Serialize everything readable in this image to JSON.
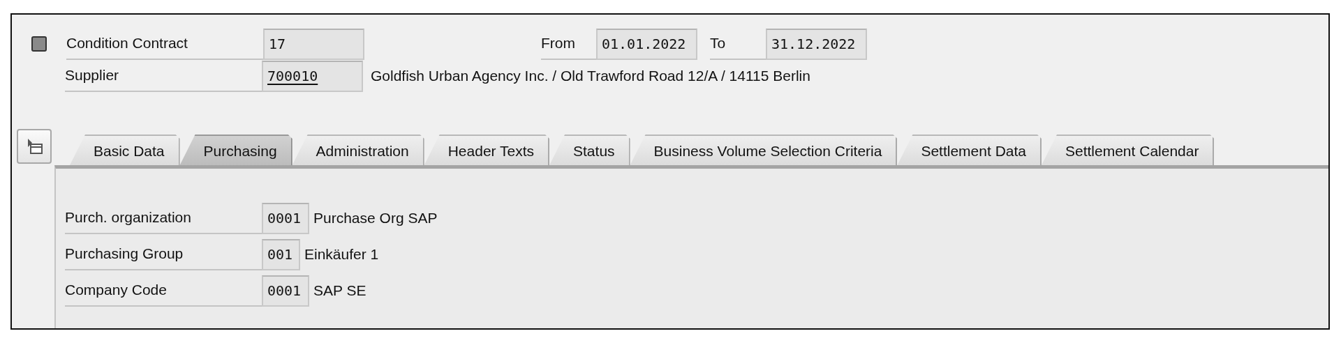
{
  "header": {
    "contract": {
      "label": "Condition Contract",
      "value": "17"
    },
    "from": {
      "label": "From",
      "value": "01.01.2022"
    },
    "to": {
      "label": "To",
      "value": "31.12.2022"
    },
    "supplier": {
      "label": "Supplier",
      "value": "700010",
      "underlined": true,
      "description": "Goldfish Urban Agency Inc. / Old Trawford Road 12/A / 14115 Berlin"
    }
  },
  "tabs": [
    {
      "label": "Basic Data",
      "selected": false
    },
    {
      "label": "Purchasing",
      "selected": true
    },
    {
      "label": "Administration",
      "selected": false
    },
    {
      "label": "Header Texts",
      "selected": false
    },
    {
      "label": "Status",
      "selected": false
    },
    {
      "label": "Business Volume Selection Criteria",
      "selected": false
    },
    {
      "label": "Settlement Data",
      "selected": false
    },
    {
      "label": "Settlement Calendar",
      "selected": false
    }
  ],
  "panel": {
    "fields": [
      {
        "label": "Purch. organization",
        "value": "0001",
        "description": "Purchase Org SAP"
      },
      {
        "label": "Purchasing Group",
        "value": "001",
        "description": "Einkäufer 1"
      },
      {
        "label": "Company Code",
        "value": "0001",
        "description": "SAP SE"
      }
    ]
  }
}
